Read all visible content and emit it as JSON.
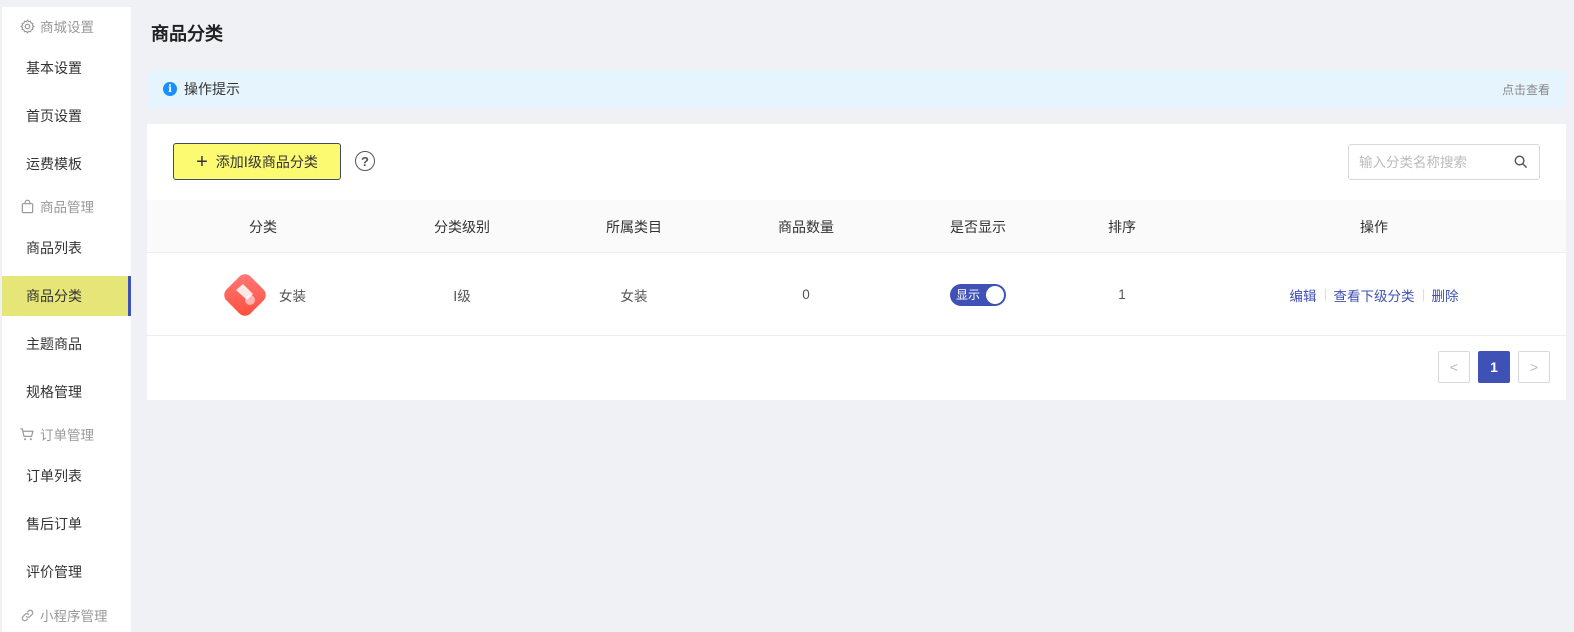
{
  "page_title": "商品分类",
  "sidebar": {
    "groups": [
      {
        "label": "商城设置",
        "icon": "gear-icon"
      },
      {
        "label": "商品管理",
        "icon": "bag-icon"
      },
      {
        "label": "订单管理",
        "icon": "cart-icon"
      },
      {
        "label": "小程序管理",
        "icon": "link-icon"
      }
    ],
    "items": [
      {
        "label": "基本设置"
      },
      {
        "label": "首页设置"
      },
      {
        "label": "运费模板"
      },
      {
        "label": "商品列表"
      },
      {
        "label": "商品分类",
        "active": true
      },
      {
        "label": "主题商品"
      },
      {
        "label": "规格管理"
      },
      {
        "label": "订单列表"
      },
      {
        "label": "售后订单"
      },
      {
        "label": "评价管理"
      }
    ]
  },
  "notice": {
    "text": "操作提示",
    "more": "点击查看",
    "icon": "info-icon"
  },
  "toolbar": {
    "add_label": "添加Ⅰ级商品分类",
    "search_placeholder": "输入分类名称搜索"
  },
  "table": {
    "headers": [
      "分类",
      "分类级别",
      "所属类目",
      "商品数量",
      "是否显示",
      "排序",
      "操作"
    ],
    "rows": [
      {
        "category": "女装",
        "level": "Ⅰ级",
        "parent": "女装",
        "count": "0",
        "visible_label": "显示",
        "visible": true,
        "sort": "1",
        "actions": [
          "编辑",
          "查看下级分类",
          "删除"
        ]
      }
    ]
  },
  "pagination": {
    "prev": "<",
    "current": "1",
    "next": ">"
  },
  "colors": {
    "accent": "#3f51b5",
    "active_bg": "#e6e678",
    "add_btn_bg": "#fcfa70",
    "notice_bg": "#e6f5fd"
  }
}
